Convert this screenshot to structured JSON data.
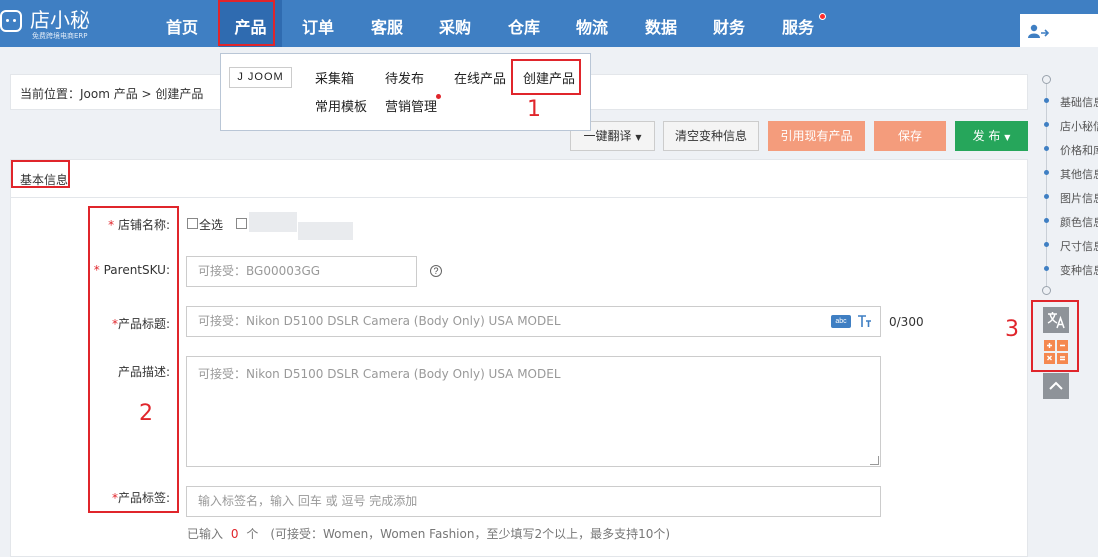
{
  "app": {
    "logo_name": "店小秘",
    "logo_sub": "免费跨境电商ERP"
  },
  "nav": {
    "items": [
      "首页",
      "产品",
      "订单",
      "客服",
      "采购",
      "仓库",
      "物流",
      "数据",
      "财务",
      "服务"
    ],
    "active": "产品"
  },
  "dropdown": {
    "platform": "J JOOM",
    "items": [
      "采集箱",
      "待发布",
      "在线产品",
      "创建产品",
      "常用模板",
      "营销管理"
    ]
  },
  "breadcrumb": "当前位置：Joom 产品 > 创建产品",
  "toolbar": {
    "translate": "一键翻译",
    "clear_variants": "清空变种信息",
    "use_existing": "引用现有产品",
    "save": "保存",
    "publish": "发 布"
  },
  "section": {
    "title": "基本信息"
  },
  "form": {
    "store_label": "店铺名称:",
    "select_all": "全选",
    "parent_sku_label": "ParentSKU:",
    "parent_sku_placeholder": "可接受：BG00003GG",
    "title_label": "产品标题:",
    "title_placeholder": "可接受：Nikon D5100 DSLR Camera (Body Only) USA MODEL",
    "title_counter": "0/300",
    "title_badge": "abc",
    "desc_label": "产品描述:",
    "desc_placeholder": "可接受：Nikon D5100 DSLR Camera (Body Only) USA MODEL",
    "tags_label": "产品标签:",
    "tags_placeholder": "输入标签名，输入 回车 或 逗号 完成添加",
    "tags_hint_prefix": "已输入",
    "tags_count": "0",
    "tags_hint_suffix": "个　(可接受：Women，Women Fashion，至少填写2个以上，最多支持10个)"
  },
  "outline": {
    "items": [
      "基础信息",
      "店小秘信息",
      "价格和库存",
      "其他信息",
      "图片信息",
      "颜色信息",
      "尺寸信息",
      "变种信息"
    ]
  },
  "annotations": {
    "labels": [
      "1",
      "2",
      "3"
    ]
  },
  "colors": {
    "nav_bg": "#3f7fc3",
    "annotation": "#e0252b",
    "save_orange": "#f49c7c",
    "publish_green": "#26a65b"
  }
}
